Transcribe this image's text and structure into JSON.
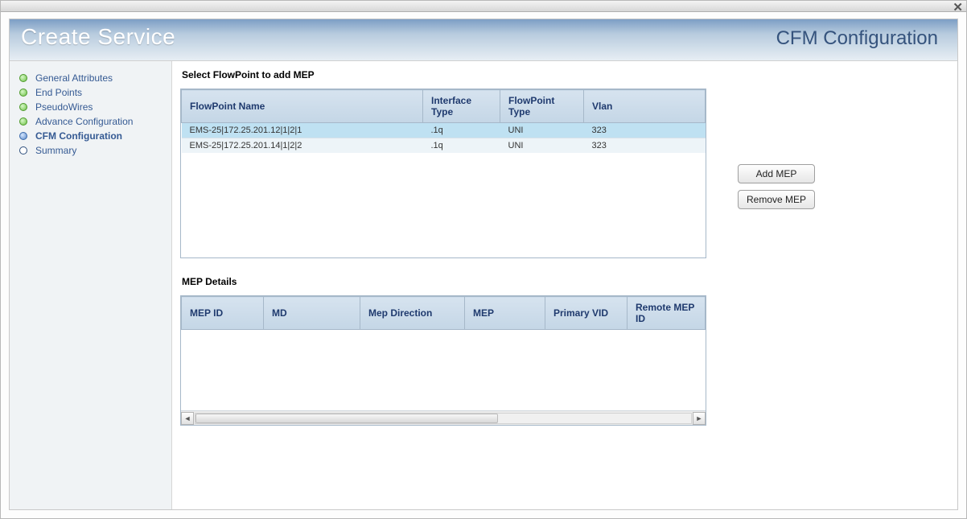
{
  "window": {
    "close_glyph": "✕"
  },
  "banner": {
    "title": "Create Service",
    "page": "CFM Configuration"
  },
  "sidebar": {
    "items": [
      {
        "label": "General Attributes",
        "state": "done"
      },
      {
        "label": "End Points",
        "state": "done"
      },
      {
        "label": "PseudoWires",
        "state": "done"
      },
      {
        "label": "Advance Configuration",
        "state": "done"
      },
      {
        "label": "CFM Configuration",
        "state": "current"
      },
      {
        "label": "Summary",
        "state": "todo"
      }
    ]
  },
  "flowpoint": {
    "section_label": "Select FlowPoint to add MEP",
    "headers": {
      "name": "FlowPoint Name",
      "iftype": "Interface Type",
      "fptype": "FlowPoint Type",
      "vlan": "Vlan"
    },
    "rows": [
      {
        "name": "EMS-25|172.25.201.12|1|2|1",
        "iftype": ".1q",
        "fptype": "UNI",
        "vlan": "323",
        "selected": true
      },
      {
        "name": "EMS-25|172.25.201.14|1|2|2",
        "iftype": ".1q",
        "fptype": "UNI",
        "vlan": "323",
        "selected": false
      }
    ]
  },
  "mep": {
    "section_label": "MEP Details",
    "headers": {
      "mepid": "MEP ID",
      "md": "MD",
      "dir": "Mep Direction",
      "mep": "MEP",
      "pvid": "Primary VID",
      "remote": "Remote MEP ID"
    }
  },
  "buttons": {
    "add": "Add MEP",
    "remove": "Remove MEP"
  },
  "scroll": {
    "left_glyph": "◄",
    "right_glyph": "►",
    "grip": "⁞⁞⁞"
  }
}
